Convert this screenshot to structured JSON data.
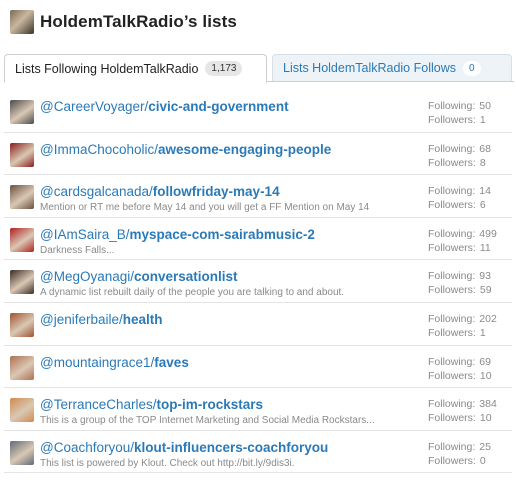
{
  "page": {
    "title": "HoldemTalkRadio’s lists"
  },
  "tabs": [
    {
      "label": "Lists Following HoldemTalkRadio",
      "count": "1,173"
    },
    {
      "label": "Lists HoldemTalkRadio Follows",
      "count": "0"
    }
  ],
  "labels": {
    "following": "Following:",
    "followers": "Followers:"
  },
  "lists": [
    {
      "user": "@CareerVoyager",
      "slug": "civic-and-government",
      "description": "",
      "following": "50",
      "followers": "1",
      "avatar_color": "#4a4a4a"
    },
    {
      "user": "@ImmaChocoholic",
      "slug": "awesome-engaging-people",
      "description": "",
      "following": "68",
      "followers": "8",
      "avatar_color": "#8a1c1c"
    },
    {
      "user": "@cardsgalcanada",
      "slug": "followfriday-may-14",
      "description": "Mention or RT me before May 14 and you will get a FF Mention on May 14",
      "following": "14",
      "followers": "6",
      "avatar_color": "#6b5040"
    },
    {
      "user": "@IAmSaira_B",
      "slug": "myspace-com-sairabmusic-2",
      "description": "Darkness Falls...",
      "following": "499",
      "followers": "11",
      "avatar_color": "#b02020"
    },
    {
      "user": "@MegOyanagi",
      "slug": "conversationlist",
      "description": "A dynamic list rebuilt daily of the people you are talking to and about.",
      "following": "93",
      "followers": "59",
      "avatar_color": "#3a2a22"
    },
    {
      "user": "@jeniferbaile",
      "slug": "health",
      "description": "",
      "following": "202",
      "followers": "1",
      "avatar_color": "#a0522d"
    },
    {
      "user": "@mountaingrace1",
      "slug": "faves",
      "description": "",
      "following": "69",
      "followers": "10",
      "avatar_color": "#b07050"
    },
    {
      "user": "@TerranceCharles",
      "slug": "top-im-rockstars",
      "description": "This is a group of the TOP Internet Marketing and Social Media Rockstars...",
      "following": "384",
      "followers": "10",
      "avatar_color": "#d08a50"
    },
    {
      "user": "@Coachforyou",
      "slug": "klout-influencers-coachforyou",
      "description": "This list is powered by Klout. Check out http://bit.ly/9dis3i.",
      "following": "25",
      "followers": "0",
      "avatar_color": "#606a78"
    }
  ]
}
